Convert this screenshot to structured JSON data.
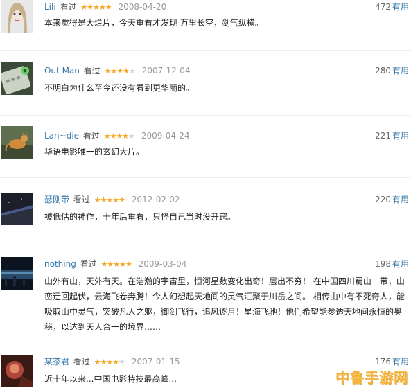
{
  "reviews": [
    {
      "user": "Lili",
      "verb": "看过",
      "stars": 5,
      "date": "2008-04-20",
      "useful_count": "472",
      "useful_label": "有用",
      "text": "本来觉得是大烂片，今天重看才发现 万里长空，剑气纵横。"
    },
    {
      "user": "Out Man",
      "verb": "看过",
      "stars": 4,
      "date": "2007-12-04",
      "useful_count": "280",
      "useful_label": "有用",
      "text": "不明白为什么至今还没有看到更华丽的。"
    },
    {
      "user": "Lan~die",
      "verb": "看过",
      "stars": 4,
      "date": "2009-04-24",
      "useful_count": "221",
      "useful_label": "有用",
      "text": "华语电影唯一的玄幻大片。"
    },
    {
      "user": "瑟刚带",
      "verb": "看过",
      "stars": 5,
      "date": "2012-02-02",
      "useful_count": "220",
      "useful_label": "有用",
      "text": "被低估的神作，十年后重看，只怪自己当时没开窍。"
    },
    {
      "user": "nothing",
      "verb": "看过",
      "stars": 5,
      "date": "2009-03-04",
      "useful_count": "198",
      "useful_label": "有用",
      "text": "山外有山，天外有天。在浩瀚的宇宙里，恒河星数变化出奇！层出不穷！ 在中国四川蜀山一带，山峦迂回起伏，云海飞卷奔腾！今人幻想起天地间的灵气汇聚于川岳之间。 相传山中有不死奇人，能吸取山中灵气，突破凡人之躯，御剑飞行，追风逐月！星海飞驰！他们希望能参透天地间永恒的奥秘，以达到天人合一的境界……"
    },
    {
      "user": "某茶君",
      "verb": "看过",
      "stars": 4,
      "date": "2007-01-15",
      "useful_count": "176",
      "useful_label": "有用",
      "text": "近十年以来...中国电影特技最高峰..."
    }
  ],
  "watermark": "中鲁手游网",
  "colors": {
    "username": "#3377aa",
    "star": "#f5a623",
    "date": "#999999",
    "watermark": "#f2b233"
  }
}
